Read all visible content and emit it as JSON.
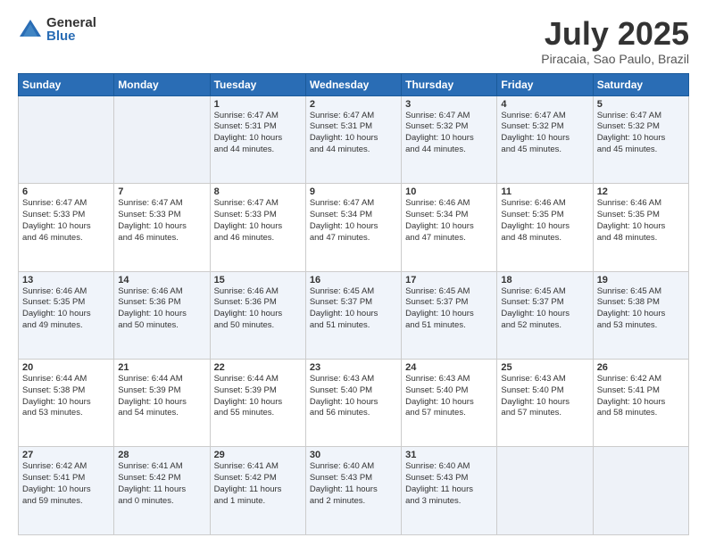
{
  "header": {
    "logo_general": "General",
    "logo_blue": "Blue",
    "month_title": "July 2025",
    "location": "Piracaia, Sao Paulo, Brazil"
  },
  "weekdays": [
    "Sunday",
    "Monday",
    "Tuesday",
    "Wednesday",
    "Thursday",
    "Friday",
    "Saturday"
  ],
  "weeks": [
    [
      {
        "day": "",
        "info": ""
      },
      {
        "day": "",
        "info": ""
      },
      {
        "day": "1",
        "info": "Sunrise: 6:47 AM\nSunset: 5:31 PM\nDaylight: 10 hours\nand 44 minutes."
      },
      {
        "day": "2",
        "info": "Sunrise: 6:47 AM\nSunset: 5:31 PM\nDaylight: 10 hours\nand 44 minutes."
      },
      {
        "day": "3",
        "info": "Sunrise: 6:47 AM\nSunset: 5:32 PM\nDaylight: 10 hours\nand 44 minutes."
      },
      {
        "day": "4",
        "info": "Sunrise: 6:47 AM\nSunset: 5:32 PM\nDaylight: 10 hours\nand 45 minutes."
      },
      {
        "day": "5",
        "info": "Sunrise: 6:47 AM\nSunset: 5:32 PM\nDaylight: 10 hours\nand 45 minutes."
      }
    ],
    [
      {
        "day": "6",
        "info": "Sunrise: 6:47 AM\nSunset: 5:33 PM\nDaylight: 10 hours\nand 46 minutes."
      },
      {
        "day": "7",
        "info": "Sunrise: 6:47 AM\nSunset: 5:33 PM\nDaylight: 10 hours\nand 46 minutes."
      },
      {
        "day": "8",
        "info": "Sunrise: 6:47 AM\nSunset: 5:33 PM\nDaylight: 10 hours\nand 46 minutes."
      },
      {
        "day": "9",
        "info": "Sunrise: 6:47 AM\nSunset: 5:34 PM\nDaylight: 10 hours\nand 47 minutes."
      },
      {
        "day": "10",
        "info": "Sunrise: 6:46 AM\nSunset: 5:34 PM\nDaylight: 10 hours\nand 47 minutes."
      },
      {
        "day": "11",
        "info": "Sunrise: 6:46 AM\nSunset: 5:35 PM\nDaylight: 10 hours\nand 48 minutes."
      },
      {
        "day": "12",
        "info": "Sunrise: 6:46 AM\nSunset: 5:35 PM\nDaylight: 10 hours\nand 48 minutes."
      }
    ],
    [
      {
        "day": "13",
        "info": "Sunrise: 6:46 AM\nSunset: 5:35 PM\nDaylight: 10 hours\nand 49 minutes."
      },
      {
        "day": "14",
        "info": "Sunrise: 6:46 AM\nSunset: 5:36 PM\nDaylight: 10 hours\nand 50 minutes."
      },
      {
        "day": "15",
        "info": "Sunrise: 6:46 AM\nSunset: 5:36 PM\nDaylight: 10 hours\nand 50 minutes."
      },
      {
        "day": "16",
        "info": "Sunrise: 6:45 AM\nSunset: 5:37 PM\nDaylight: 10 hours\nand 51 minutes."
      },
      {
        "day": "17",
        "info": "Sunrise: 6:45 AM\nSunset: 5:37 PM\nDaylight: 10 hours\nand 51 minutes."
      },
      {
        "day": "18",
        "info": "Sunrise: 6:45 AM\nSunset: 5:37 PM\nDaylight: 10 hours\nand 52 minutes."
      },
      {
        "day": "19",
        "info": "Sunrise: 6:45 AM\nSunset: 5:38 PM\nDaylight: 10 hours\nand 53 minutes."
      }
    ],
    [
      {
        "day": "20",
        "info": "Sunrise: 6:44 AM\nSunset: 5:38 PM\nDaylight: 10 hours\nand 53 minutes."
      },
      {
        "day": "21",
        "info": "Sunrise: 6:44 AM\nSunset: 5:39 PM\nDaylight: 10 hours\nand 54 minutes."
      },
      {
        "day": "22",
        "info": "Sunrise: 6:44 AM\nSunset: 5:39 PM\nDaylight: 10 hours\nand 55 minutes."
      },
      {
        "day": "23",
        "info": "Sunrise: 6:43 AM\nSunset: 5:40 PM\nDaylight: 10 hours\nand 56 minutes."
      },
      {
        "day": "24",
        "info": "Sunrise: 6:43 AM\nSunset: 5:40 PM\nDaylight: 10 hours\nand 57 minutes."
      },
      {
        "day": "25",
        "info": "Sunrise: 6:43 AM\nSunset: 5:40 PM\nDaylight: 10 hours\nand 57 minutes."
      },
      {
        "day": "26",
        "info": "Sunrise: 6:42 AM\nSunset: 5:41 PM\nDaylight: 10 hours\nand 58 minutes."
      }
    ],
    [
      {
        "day": "27",
        "info": "Sunrise: 6:42 AM\nSunset: 5:41 PM\nDaylight: 10 hours\nand 59 minutes."
      },
      {
        "day": "28",
        "info": "Sunrise: 6:41 AM\nSunset: 5:42 PM\nDaylight: 11 hours\nand 0 minutes."
      },
      {
        "day": "29",
        "info": "Sunrise: 6:41 AM\nSunset: 5:42 PM\nDaylight: 11 hours\nand 1 minute."
      },
      {
        "day": "30",
        "info": "Sunrise: 6:40 AM\nSunset: 5:43 PM\nDaylight: 11 hours\nand 2 minutes."
      },
      {
        "day": "31",
        "info": "Sunrise: 6:40 AM\nSunset: 5:43 PM\nDaylight: 11 hours\nand 3 minutes."
      },
      {
        "day": "",
        "info": ""
      },
      {
        "day": "",
        "info": ""
      }
    ]
  ]
}
